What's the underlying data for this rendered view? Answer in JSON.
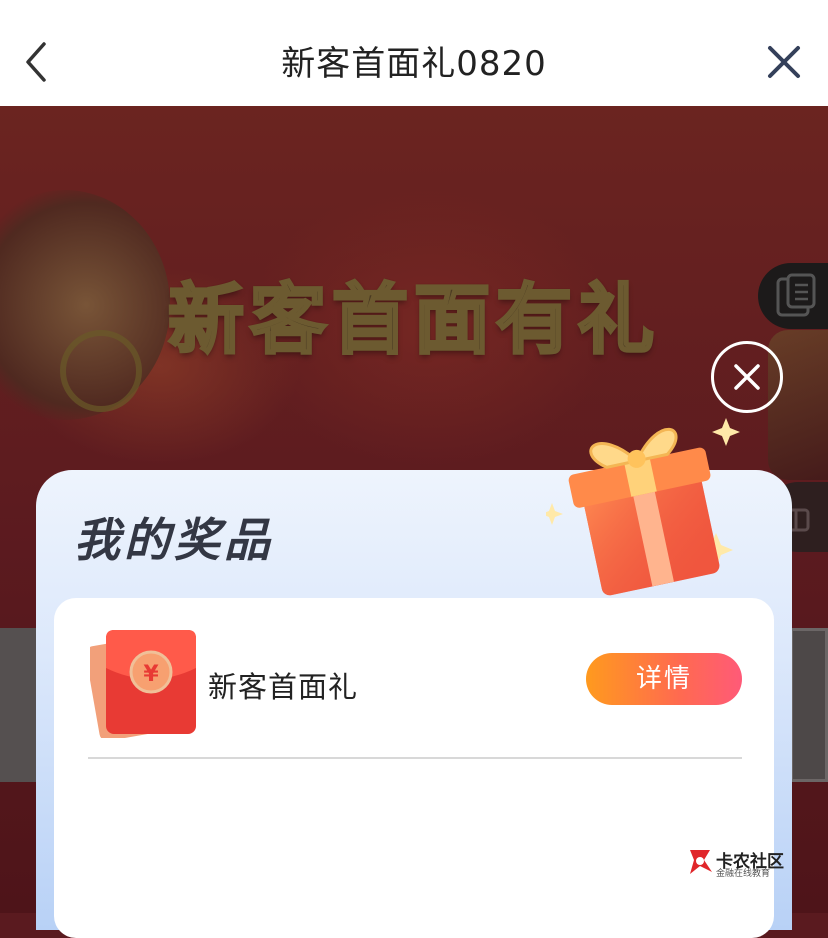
{
  "nav": {
    "title": "新客首面礼0820",
    "back_icon": "chevron-left-icon",
    "close_icon": "close-icon"
  },
  "banner": {
    "headline": "新客首面有礼"
  },
  "popup": {
    "title": "我的奖品",
    "close_icon": "circle-close-icon",
    "gift_icon": "gift-box-icon",
    "prizes": [
      {
        "name": "新客首面礼",
        "icon": "red-envelope-icon",
        "envelope_symbol": "¥",
        "action_label": "详情"
      }
    ]
  },
  "watermark": {
    "title": "卡农社区",
    "subtitle": "金融在线教育"
  },
  "colors": {
    "accent_gradient_start": "#ff9a1e",
    "accent_gradient_end": "#ff5a78",
    "popup_bg": "#dce8fb",
    "envelope_red": "#e63a34"
  }
}
